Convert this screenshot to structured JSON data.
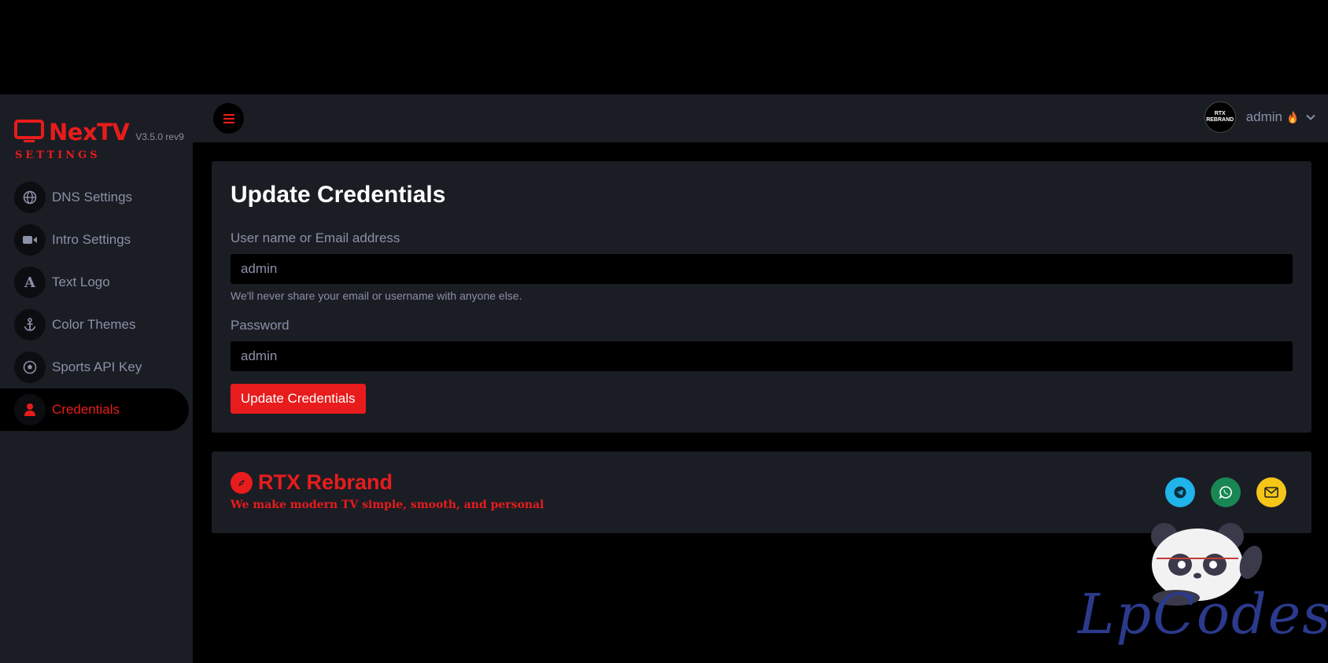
{
  "brand": {
    "name": "NexTV",
    "version": "V3.5.0 rev9",
    "subtitle": "SETTINGS",
    "color": "#e81c1c"
  },
  "sidebar": {
    "items": [
      {
        "label": "DNS Settings",
        "icon": "globe-icon",
        "active": false
      },
      {
        "label": "Intro Settings",
        "icon": "video-camera-icon",
        "active": false
      },
      {
        "label": "Text Logo",
        "icon": "letter-a-icon",
        "active": false
      },
      {
        "label": "Color Themes",
        "icon": "anchor-icon",
        "active": false
      },
      {
        "label": "Sports API Key",
        "icon": "soccer-ball-icon",
        "active": false
      },
      {
        "label": "Credentials",
        "icon": "user-icon",
        "active": true
      }
    ]
  },
  "topbar": {
    "menu_icon": "hamburger-icon",
    "user": {
      "name": "admin",
      "avatar_text_line1": "RTX",
      "avatar_text_line2": "REBRAND"
    }
  },
  "credentials_form": {
    "title": "Update Credentials",
    "username_label": "User name or Email address",
    "username_value": "admin",
    "username_help": "We'll never share your email or username with anyone else.",
    "password_label": "Password",
    "password_value": "admin",
    "submit_label": "Update Credentials"
  },
  "footer": {
    "title": "RTX Rebrand",
    "tagline": "We make modern TV simple, smooth, and personal",
    "social": [
      {
        "icon": "telegram-icon",
        "color": "#1fb4ea"
      },
      {
        "icon": "whatsapp-icon",
        "color": "#198754"
      },
      {
        "icon": "mail-icon",
        "color": "#f5c518"
      }
    ]
  },
  "watermark": {
    "text": "LpCodes"
  },
  "colors": {
    "accent": "#e81c1c",
    "panel": "#1b1d24",
    "muted_text": "#8a90a8"
  }
}
